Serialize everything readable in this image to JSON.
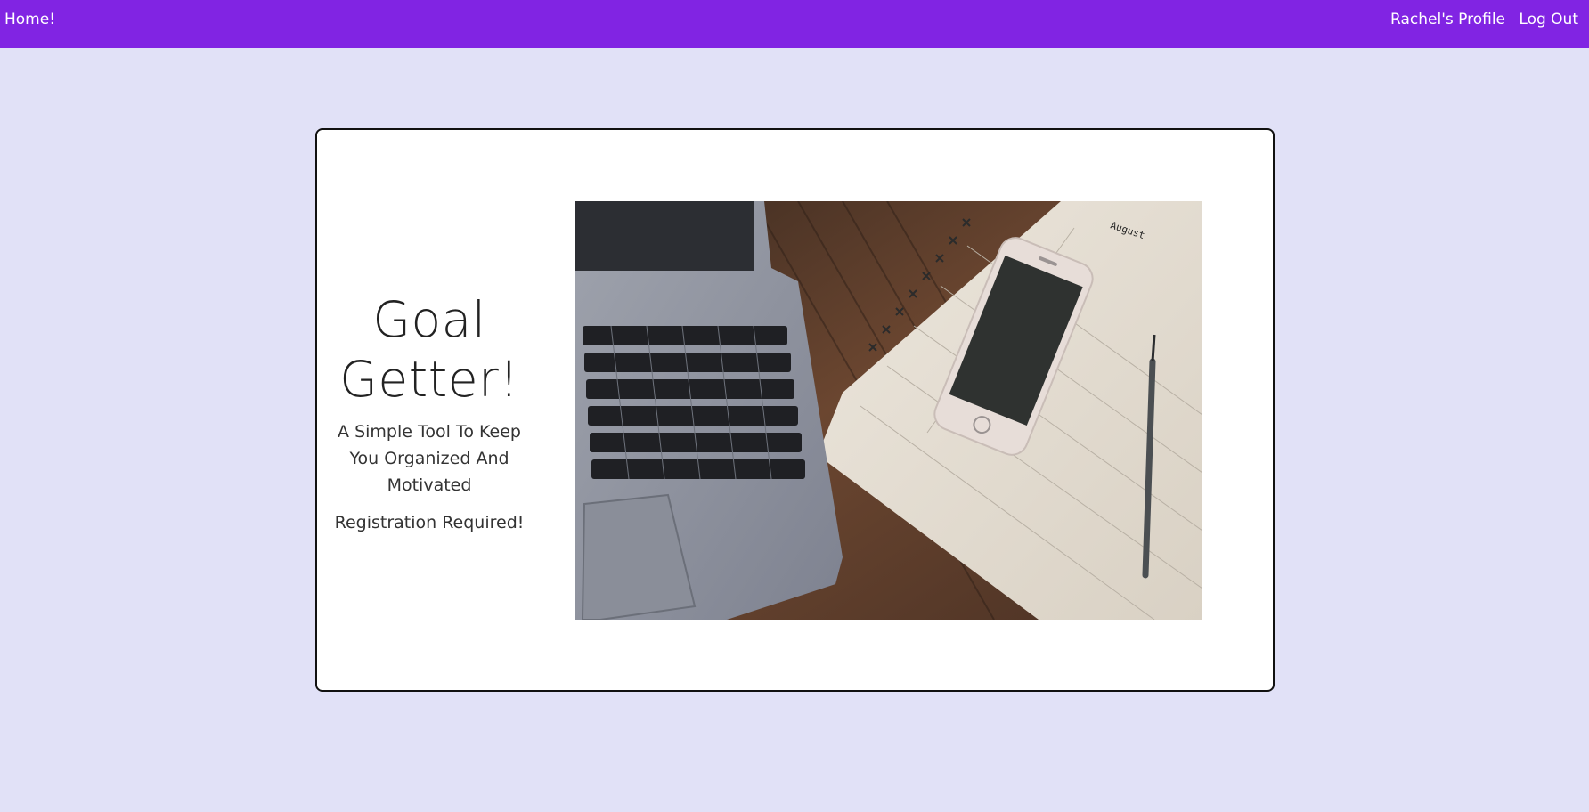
{
  "nav": {
    "home_label": "Home!",
    "profile_label": "Rachel's Profile",
    "logout_label": "Log Out"
  },
  "hero": {
    "title_line1": "Goal",
    "title_line2": "Getter!",
    "tagline": "A Simple Tool To Keep You Organized And Motivated",
    "note": "Registration Required!"
  },
  "photo": {
    "notebook_heading": "August"
  },
  "colors": {
    "page_background": "#e1e1f7",
    "navbar": "#8124e3",
    "card_background": "#ffffff",
    "card_border": "#111111"
  }
}
